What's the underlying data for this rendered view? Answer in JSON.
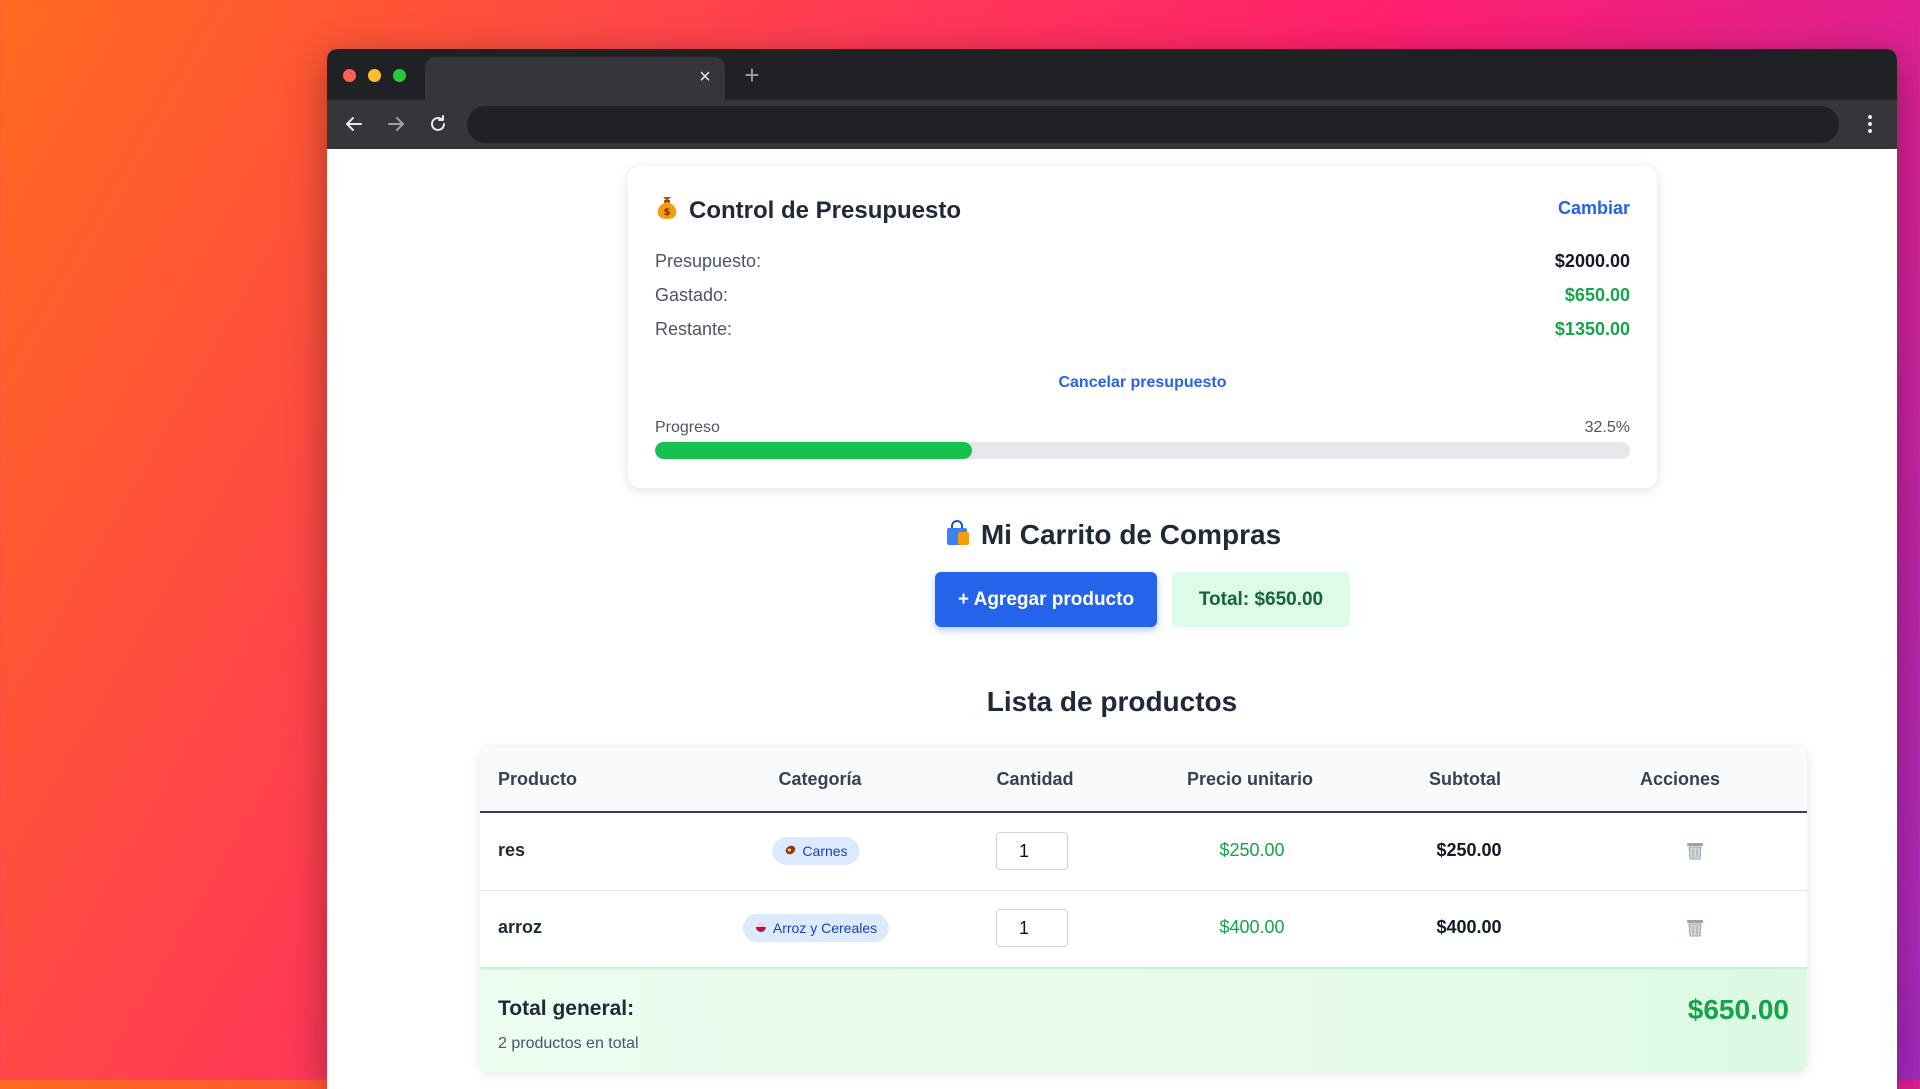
{
  "browser": {
    "tab_close": "×",
    "new_tab": "+"
  },
  "budget": {
    "icon": "money-bag-icon",
    "title": "Control de Presupuesto",
    "change_label": "Cambiar",
    "rows": [
      {
        "label": "Presupuesto:",
        "value": "$2000.00",
        "color": "#111827"
      },
      {
        "label": "Gastado:",
        "value": "$650.00",
        "color": "#16a34a"
      },
      {
        "label": "Restante:",
        "value": "$1350.00",
        "color": "#16a34a"
      }
    ],
    "cancel_label": "Cancelar presupuesto",
    "progress_label": "Progreso",
    "progress_text": "32.5%",
    "progress_fraction": 0.325,
    "progress_color": "#16c24f"
  },
  "cart": {
    "icon": "shopping-bag-icon",
    "title": "Mi Carrito de Compras",
    "add_label": "+ Agregar producto",
    "total_label": "Total: $650.00"
  },
  "list": {
    "title": "Lista de productos",
    "columns": [
      "Producto",
      "Categoría",
      "Cantidad",
      "Precio unitario",
      "Subtotal",
      "Acciones"
    ],
    "rows": [
      {
        "name": "res",
        "category": "Carnes",
        "category_icon": "meat-icon",
        "quantity": "1",
        "unit_price": "$250.00",
        "subtotal": "$250.00",
        "action_icon": "trash-icon"
      },
      {
        "name": "arroz",
        "category": "Arroz y Cereales",
        "category_icon": "rice-bowl-icon",
        "quantity": "1",
        "unit_price": "$400.00",
        "subtotal": "$400.00",
        "action_icon": "trash-icon"
      }
    ],
    "footer": {
      "label": "Total general:",
      "count": "2 productos en total",
      "amount": "$650.00"
    }
  },
  "colors": {
    "accent": "#2563eb",
    "money_green": "#16a34a"
  }
}
